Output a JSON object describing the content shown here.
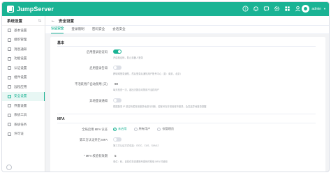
{
  "app": {
    "name": "JumpServer"
  },
  "header": {
    "icons": [
      "help-icon",
      "notification-icon",
      "message-icon",
      "settings-icon",
      "grid-icon",
      "user-icon"
    ],
    "user": {
      "name": "admin"
    }
  },
  "sidebar": {
    "title": "系统设置",
    "toggle": "⇆",
    "items": [
      {
        "label": "基本设置"
      },
      {
        "label": "组织管理"
      },
      {
        "label": "消息通知"
      },
      {
        "label": "功能设置"
      },
      {
        "label": "认证设置"
      },
      {
        "label": "组件设置"
      },
      {
        "label": "远程应用"
      },
      {
        "label": "安全设置"
      },
      {
        "label": "界面设置"
      },
      {
        "label": "系统工具"
      },
      {
        "label": "系统任务"
      },
      {
        "label": "许可证"
      }
    ],
    "active_index": 7
  },
  "page": {
    "back": "←",
    "title": "安全设置",
    "tabs": [
      {
        "label": "认证安全"
      },
      {
        "label": "登录限制"
      },
      {
        "label": "密码安全"
      },
      {
        "label": "会话安全"
      }
    ],
    "active_tab": 0
  },
  "form": {
    "basic": {
      "title": "基本",
      "rows": [
        {
          "label": "启用登录验证码",
          "value": "on",
          "hint": "开启验证码，防止机器人登录"
        },
        {
          "label": "启用登录告知",
          "value": "off",
          "hint": "跨城域登录通知，然后登录后通知用户账号中心（如：南京、北京）"
        },
        {
          "label": "不活跃用户自动禁用 (天)",
          "value": "90",
          "hint": "每天检查一次，超出天数自动禁用不活跃用户"
        },
        {
          "label": "异地登录通知",
          "value": "off",
          "hint": "根据登录 IP 是否所属常用登录地进行判断，若账号在非常用城市登录，会发送异地登录提醒"
        }
      ]
    },
    "mfa": {
      "title": "MFA",
      "rows": [
        {
          "label": "全局启用 MFA 认证",
          "options": [
            "未启用",
            "所有用户",
            "仅管理员"
          ],
          "selected": 0
        },
        {
          "label": "第三方认证开启 MFA",
          "value": "off",
          "hint": "第三方认证方式包括：OIDC、CAS、SAML2"
        },
        {
          "label": "* MFA 校验有效期",
          "value": "5",
          "hint": "单位：秒，目前仅在查看账号密码时校验 MFA 时使用"
        }
      ]
    }
  }
}
